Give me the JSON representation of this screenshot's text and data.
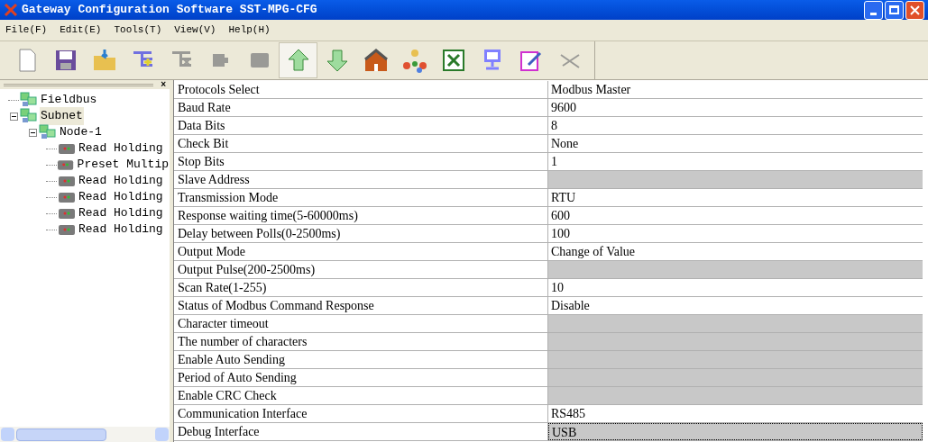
{
  "window": {
    "title": "Gateway Configuration Software SST-MPG-CFG"
  },
  "menu": [
    "File(F)",
    "Edit(E)",
    "Tools(T)",
    "View(V)",
    "Help(H)"
  ],
  "toolbar": [
    {
      "kind": "new",
      "disabled": false,
      "pressed": false
    },
    {
      "kind": "save",
      "disabled": false,
      "pressed": false
    },
    {
      "kind": "open",
      "disabled": false,
      "pressed": false
    },
    {
      "kind": "add-node",
      "disabled": false,
      "pressed": false
    },
    {
      "kind": "delete-node",
      "disabled": true,
      "pressed": false
    },
    {
      "kind": "plug",
      "disabled": true,
      "pressed": false
    },
    {
      "kind": "card",
      "disabled": true,
      "pressed": false
    },
    {
      "kind": "upload",
      "disabled": false,
      "pressed": true
    },
    {
      "kind": "download",
      "disabled": false,
      "pressed": false
    },
    {
      "kind": "home",
      "disabled": false,
      "pressed": false
    },
    {
      "kind": "network",
      "disabled": false,
      "pressed": false
    },
    {
      "kind": "excel",
      "disabled": false,
      "pressed": false
    },
    {
      "kind": "monitor",
      "disabled": false,
      "pressed": false
    },
    {
      "kind": "edit",
      "disabled": false,
      "pressed": false
    },
    {
      "kind": "tool",
      "disabled": true,
      "pressed": false
    }
  ],
  "pane_close": "×",
  "tree": [
    {
      "label": "Fieldbus",
      "kind": "network",
      "selected": false
    },
    {
      "label": "Subnet",
      "kind": "network",
      "selected": true,
      "expanded": true,
      "children": [
        {
          "label": "Node-1",
          "kind": "network",
          "selected": false,
          "expanded": true,
          "children": [
            {
              "label": "Read Holding",
              "kind": "command",
              "selected": false
            },
            {
              "label": "Preset Multip",
              "kind": "command",
              "selected": false
            },
            {
              "label": "Read Holding",
              "kind": "command",
              "selected": false
            },
            {
              "label": "Read Holding",
              "kind": "command",
              "selected": false
            },
            {
              "label": "Read Holding",
              "kind": "command",
              "selected": false
            },
            {
              "label": "Read Holding",
              "kind": "command",
              "selected": false
            }
          ]
        }
      ]
    }
  ],
  "properties": [
    {
      "name": "Protocols Select",
      "value": "Modbus Master",
      "disabled": false,
      "selected": false
    },
    {
      "name": "Baud Rate",
      "value": "9600",
      "disabled": false,
      "selected": false
    },
    {
      "name": "Data Bits",
      "value": "8",
      "disabled": false,
      "selected": false
    },
    {
      "name": "Check Bit",
      "value": "None",
      "disabled": false,
      "selected": false
    },
    {
      "name": "Stop Bits",
      "value": "1",
      "disabled": false,
      "selected": false
    },
    {
      "name": "Slave Address",
      "disabled": true,
      "selected": false
    },
    {
      "name": "Transmission Mode",
      "value": "RTU",
      "disabled": false,
      "selected": false
    },
    {
      "name": "Response waiting time(5-60000ms)",
      "value": "600",
      "disabled": false,
      "selected": false
    },
    {
      "name": "Delay between Polls(0-2500ms)",
      "value": "100",
      "disabled": false,
      "selected": false
    },
    {
      "name": "Output Mode",
      "value": "Change of Value",
      "disabled": false,
      "selected": false
    },
    {
      "name": "Output Pulse(200-2500ms)",
      "disabled": true,
      "selected": false
    },
    {
      "name": "Scan Rate(1-255)",
      "value": "10",
      "disabled": false,
      "selected": false
    },
    {
      "name": "Status of Modbus Command Response",
      "value": "Disable",
      "disabled": false,
      "selected": false
    },
    {
      "name": "Character timeout",
      "disabled": true,
      "selected": false
    },
    {
      "name": "The number of characters",
      "disabled": true,
      "selected": false
    },
    {
      "name": "Enable Auto Sending",
      "disabled": true,
      "selected": false
    },
    {
      "name": "Period of Auto Sending",
      "disabled": true,
      "selected": false
    },
    {
      "name": "Enable CRC Check",
      "disabled": true,
      "selected": false
    },
    {
      "name": "Communication Interface",
      "value": "RS485",
      "disabled": false,
      "selected": false
    },
    {
      "name": "Debug Interface",
      "value": "USB",
      "disabled": true,
      "selected": true
    }
  ]
}
